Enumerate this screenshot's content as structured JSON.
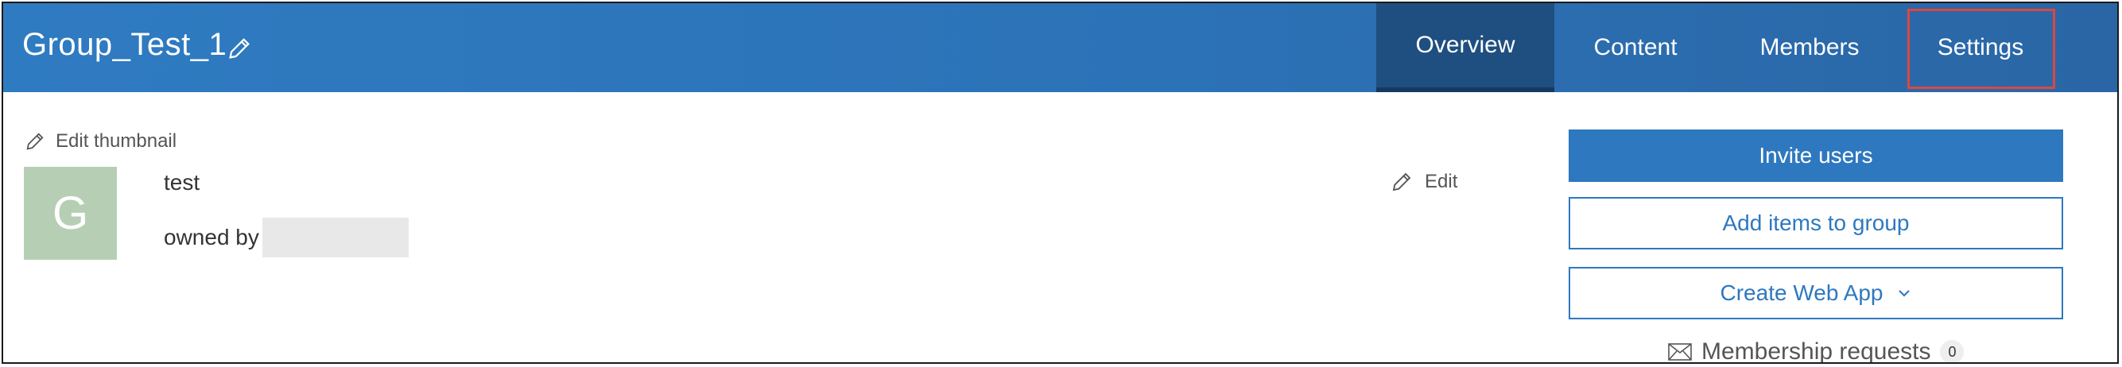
{
  "group": {
    "title": "Group_Test_1",
    "summary": "test",
    "owned_by_label": "owned by",
    "avatar_letter": "G"
  },
  "tabs": [
    {
      "label": "Overview",
      "active": true
    },
    {
      "label": "Content",
      "active": false
    },
    {
      "label": "Members",
      "active": false
    },
    {
      "label": "Settings",
      "active": false,
      "highlighted": true
    }
  ],
  "thumbnail": {
    "edit_label": "Edit thumbnail"
  },
  "description": {
    "edit_label": "Edit"
  },
  "actions": {
    "invite_users": "Invite users",
    "add_items": "Add items to group",
    "create_web_app": "Create Web App"
  },
  "membership": {
    "label": "Membership requests",
    "count": "0"
  },
  "colors": {
    "header_bg": "#2f7bc1",
    "active_tab_bg": "#1f4f80",
    "accent": "#2e78bf",
    "highlight": "#e0463f",
    "avatar_bg": "#b6cfb4"
  },
  "icons": {
    "title_edit": "pencil-icon",
    "thumb_edit": "pencil-icon",
    "desc_edit": "pencil-icon",
    "dropdown": "chevron-down-icon",
    "membership": "envelope-icon"
  }
}
